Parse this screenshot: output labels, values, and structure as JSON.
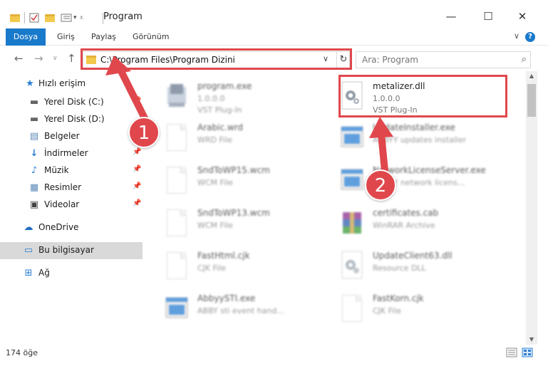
{
  "window": {
    "title": "Program",
    "minimize_glyph": "—",
    "maximize_glyph": "☐",
    "close_glyph": "✕"
  },
  "ribbon": {
    "tabs": [
      "Dosya",
      "Giriş",
      "Paylaş",
      "Görünüm"
    ],
    "help_glyph": "?",
    "expand_glyph": "∨"
  },
  "address": {
    "path": "C:\\Program Files\\Program Dizini",
    "search_placeholder": "Ara: Program"
  },
  "sidebar": {
    "items": [
      {
        "label": "Hızlı erişim",
        "icon": "star-icon",
        "glyph": "★"
      },
      {
        "label": "Yerel Disk (C:)",
        "icon": "drive-icon",
        "glyph": "▬"
      },
      {
        "label": "Yerel Disk (D:)",
        "icon": "drive-icon",
        "glyph": "▬"
      },
      {
        "label": "Belgeler",
        "icon": "documents-icon",
        "glyph": "▤"
      },
      {
        "label": "İndirmeler",
        "icon": "download-icon",
        "glyph": "↓"
      },
      {
        "label": "Müzik",
        "icon": "music-icon",
        "glyph": "♪"
      },
      {
        "label": "Resimler",
        "icon": "pictures-icon",
        "glyph": "▦"
      },
      {
        "label": "Videolar",
        "icon": "video-icon",
        "glyph": "▣"
      },
      {
        "label": "OneDrive",
        "icon": "cloud-icon",
        "glyph": "☁"
      },
      {
        "label": "Bu bilgisayar",
        "icon": "computer-icon",
        "glyph": "▭"
      },
      {
        "label": "Ağ",
        "icon": "network-icon",
        "glyph": "⊞"
      }
    ]
  },
  "files": [
    {
      "name": "program.exe",
      "l1": "1.0.0.0",
      "l2": "VST Plug-In"
    },
    {
      "name": "metalizer.dll",
      "l1": "1.0.0.0",
      "l2": "VST Plug-In"
    },
    {
      "name": "Arabic.wrd",
      "l1": "WRD File",
      "l2": ""
    },
    {
      "name": "UpdateInstaller.exe",
      "l1": "ABBYY updates installer",
      "l2": ""
    },
    {
      "name": "SndToWP15.wcm",
      "l1": "WCM File",
      "l2": ""
    },
    {
      "name": "NetworkLicenseServer.exe",
      "l1": "ABBYY network licens...",
      "l2": ""
    },
    {
      "name": "SndToWP13.wcm",
      "l1": "WCM File",
      "l2": ""
    },
    {
      "name": "certificates.cab",
      "l1": "WinRAR Archive",
      "l2": ""
    },
    {
      "name": "FastHtml.cjk",
      "l1": "CJK File",
      "l2": ""
    },
    {
      "name": "UpdateClient63.dll",
      "l1": "Resource DLL",
      "l2": ""
    },
    {
      "name": "AbbyySTI.exe",
      "l1": "ABBY sti event hand...",
      "l2": ""
    },
    {
      "name": "FastKorn.cjk",
      "l1": "CJK File",
      "l2": ""
    }
  ],
  "status": {
    "count": "174 öğe"
  },
  "annotations": {
    "badge1": "1",
    "badge2": "2",
    "color": "#e0474c"
  }
}
